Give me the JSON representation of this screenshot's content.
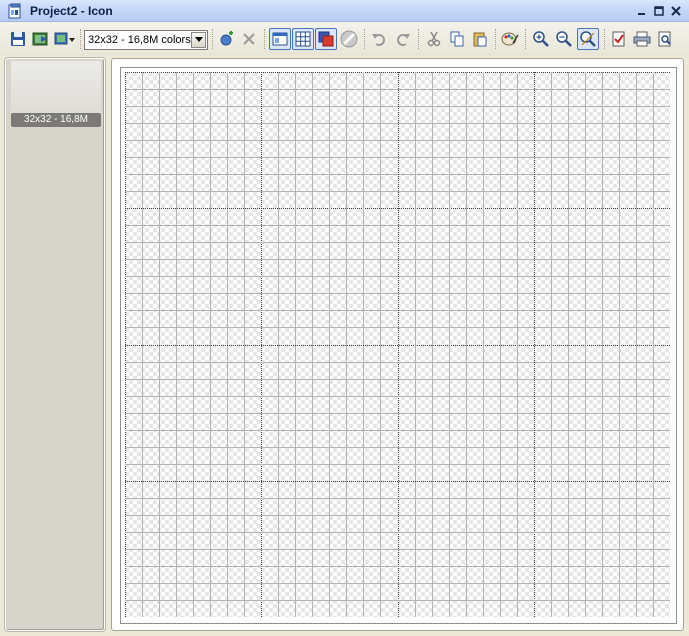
{
  "window": {
    "title": "Project2 - Icon"
  },
  "toolbar": {
    "color_depth_selected": "32x32 - 16,8M colors"
  },
  "left_panel": {
    "thumbnails": [
      {
        "label": "32x32 - 16,8M"
      }
    ]
  },
  "canvas": {
    "grid_size": 32,
    "major_every": 8
  },
  "colors": {
    "grid_minor": "#b4b4b4",
    "grid_major": "#404040",
    "checker_light": "#ffffff",
    "checker_dark": "#e6e6e6",
    "pressed_border": "#4b73b9"
  }
}
